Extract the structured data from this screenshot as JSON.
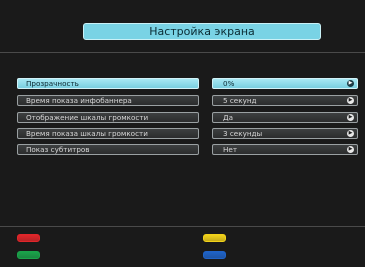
{
  "title": "Настройка экрана",
  "settings": [
    {
      "label": "Прозрачность",
      "value": "0%",
      "active": true
    },
    {
      "label": "Время показа инфобаннера",
      "value": "5 секунд",
      "active": false
    },
    {
      "label": "Отображение шкалы громкости",
      "value": "Да",
      "active": false
    },
    {
      "label": "Время показа шкалы громкости",
      "value": "3 секунды",
      "active": false
    },
    {
      "label": "Показ субтитров",
      "value": "Нет",
      "active": false
    }
  ],
  "color_keys": {
    "red": "#e0262a",
    "green": "#1aa34a",
    "yellow": "#f2d21a",
    "blue": "#1f63c8"
  },
  "icons": {
    "value_arrow": "chevron-right-circle-icon"
  }
}
